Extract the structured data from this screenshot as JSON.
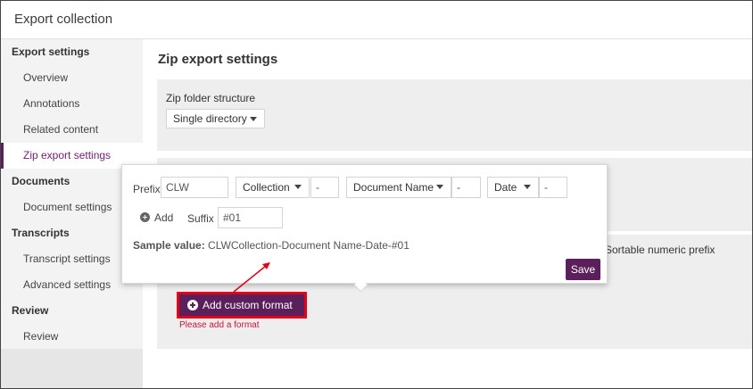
{
  "header": {
    "title": "Export collection"
  },
  "sidebar": {
    "items": [
      {
        "label": "Export settings",
        "type": "section"
      },
      {
        "label": "Overview",
        "type": "sub"
      },
      {
        "label": "Annotations",
        "type": "sub"
      },
      {
        "label": "Related content",
        "type": "sub"
      },
      {
        "label": "Zip export settings",
        "type": "sub",
        "active": true
      },
      {
        "label": "Documents",
        "type": "section"
      },
      {
        "label": "Document settings",
        "type": "sub"
      },
      {
        "label": "Transcripts",
        "type": "section"
      },
      {
        "label": "Transcript settings",
        "type": "sub"
      },
      {
        "label": "Advanced settings",
        "type": "sub"
      },
      {
        "label": "Review",
        "type": "section"
      },
      {
        "label": "Review",
        "type": "sub"
      }
    ]
  },
  "main": {
    "title": "Zip export settings",
    "zip_folder": {
      "label": "Zip folder structure",
      "value": "Single directory"
    },
    "sortable_label": "Sortable numeric prefix",
    "add_custom_format_label": "Add custom format",
    "error": "Please add a format"
  },
  "popup": {
    "prefix_label": "Prefix",
    "prefix_value": "CLW",
    "token1": "Collection",
    "sep1": "-",
    "token2": "Document Name",
    "sep2": "-",
    "token3": "Date",
    "sep3": "-",
    "add_label": "Add",
    "suffix_label": "Suffix",
    "suffix_value": "#01",
    "sample_label": "Sample value:",
    "sample_value": "CLWCollection-Document Name-Date-#01",
    "save_label": "Save"
  },
  "colors": {
    "accent": "#5b1f5b",
    "highlight": "#e0001a",
    "error": "#c0143c"
  }
}
